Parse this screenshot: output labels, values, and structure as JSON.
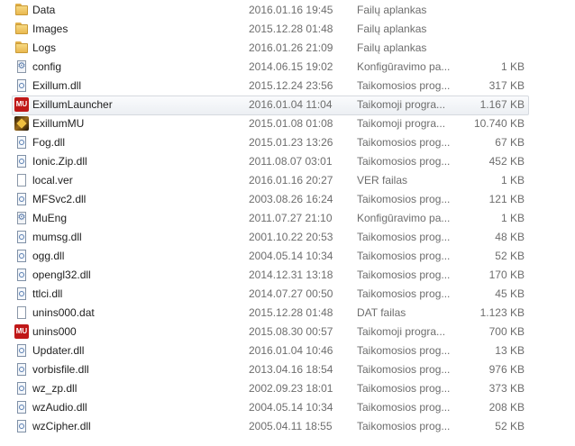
{
  "files": [
    {
      "name": "Data",
      "date": "2016.01.16 19:45",
      "type": "Failų aplankas",
      "size": "",
      "icon": "folder-icon"
    },
    {
      "name": "Images",
      "date": "2015.12.28 01:48",
      "type": "Failų aplankas",
      "size": "",
      "icon": "folder-icon"
    },
    {
      "name": "Logs",
      "date": "2016.01.26 21:09",
      "type": "Failų aplankas",
      "size": "",
      "icon": "folder-icon"
    },
    {
      "name": "config",
      "date": "2014.06.15 19:02",
      "type": "Konfigūravimo pa...",
      "size": "1 KB",
      "icon": "config-file-icon"
    },
    {
      "name": "Exillum.dll",
      "date": "2015.12.24 23:56",
      "type": "Taikomosios prog...",
      "size": "317 KB",
      "icon": "dll-file-icon"
    },
    {
      "name": "ExillumLauncher",
      "date": "2016.01.04 11:04",
      "type": "Taikomoji progra...",
      "size": "1.167 KB",
      "icon": "mu-app-icon",
      "selected": true
    },
    {
      "name": "ExillumMU",
      "date": "2015.01.08 01:08",
      "type": "Taikomoji progra...",
      "size": "10.740 KB",
      "icon": "exillum-app-icon"
    },
    {
      "name": "Fog.dll",
      "date": "2015.01.23 13:26",
      "type": "Taikomosios prog...",
      "size": "67 KB",
      "icon": "dll-file-icon"
    },
    {
      "name": "Ionic.Zip.dll",
      "date": "2011.08.07 03:01",
      "type": "Taikomosios prog...",
      "size": "452 KB",
      "icon": "dll-file-icon"
    },
    {
      "name": "local.ver",
      "date": "2016.01.16 20:27",
      "type": "VER failas",
      "size": "1 KB",
      "icon": "document-icon"
    },
    {
      "name": "MFSvc2.dll",
      "date": "2003.08.26 16:24",
      "type": "Taikomosios prog...",
      "size": "121 KB",
      "icon": "dll-file-icon"
    },
    {
      "name": "MuEng",
      "date": "2011.07.27 21:10",
      "type": "Konfigūravimo pa...",
      "size": "1 KB",
      "icon": "config-file-icon"
    },
    {
      "name": "mumsg.dll",
      "date": "2001.10.22 20:53",
      "type": "Taikomosios prog...",
      "size": "48 KB",
      "icon": "dll-file-icon"
    },
    {
      "name": "ogg.dll",
      "date": "2004.05.14 10:34",
      "type": "Taikomosios prog...",
      "size": "52 KB",
      "icon": "dll-file-icon"
    },
    {
      "name": "opengl32.dll",
      "date": "2014.12.31 13:18",
      "type": "Taikomosios prog...",
      "size": "170 KB",
      "icon": "dll-file-icon"
    },
    {
      "name": "ttlci.dll",
      "date": "2014.07.27 00:50",
      "type": "Taikomosios prog...",
      "size": "45 KB",
      "icon": "dll-file-icon"
    },
    {
      "name": "unins000.dat",
      "date": "2015.12.28 01:48",
      "type": "DAT failas",
      "size": "1.123 KB",
      "icon": "document-icon"
    },
    {
      "name": "unins000",
      "date": "2015.08.30 00:57",
      "type": "Taikomoji progra...",
      "size": "700 KB",
      "icon": "mu-app-icon"
    },
    {
      "name": "Updater.dll",
      "date": "2016.01.04 10:46",
      "type": "Taikomosios prog...",
      "size": "13 KB",
      "icon": "dll-file-icon"
    },
    {
      "name": "vorbisfile.dll",
      "date": "2013.04.16 18:54",
      "type": "Taikomosios prog...",
      "size": "976 KB",
      "icon": "dll-file-icon"
    },
    {
      "name": "wz_zp.dll",
      "date": "2002.09.23 18:01",
      "type": "Taikomosios prog...",
      "size": "373 KB",
      "icon": "dll-file-icon"
    },
    {
      "name": "wzAudio.dll",
      "date": "2004.05.14 10:34",
      "type": "Taikomosios prog...",
      "size": "208 KB",
      "icon": "dll-file-icon"
    },
    {
      "name": "wzCipher.dll",
      "date": "2005.04.11 18:55",
      "type": "Taikomosios prog...",
      "size": "52 KB",
      "icon": "dll-file-icon"
    }
  ]
}
